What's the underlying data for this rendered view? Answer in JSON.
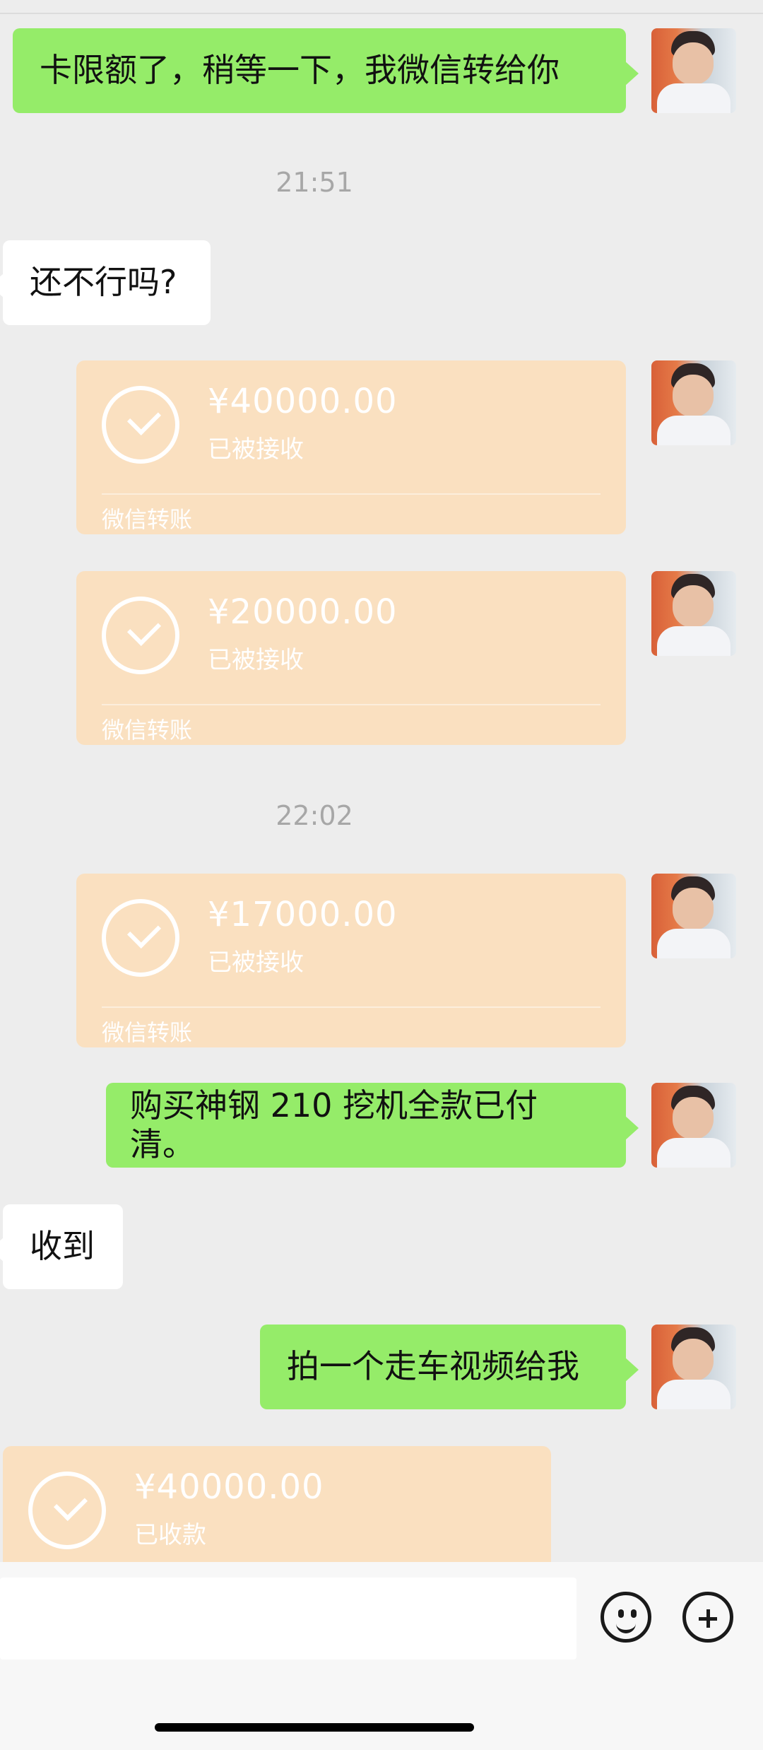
{
  "messages": {
    "outgoing_1": "卡限额了，稍等一下，我微信转给你",
    "incoming_1": "还不行吗?",
    "outgoing_2": "购买神钢 210 挖机全款已付清。",
    "incoming_2": "收到",
    "outgoing_3": "拍一个走车视频给我"
  },
  "timestamps": {
    "time_1": "21:51",
    "time_2": "22:02"
  },
  "transfers": [
    {
      "amount": "¥40000.00",
      "status": "已被接收",
      "label": "微信转账"
    },
    {
      "amount": "¥20000.00",
      "status": "已被接收",
      "label": "微信转账"
    },
    {
      "amount": "¥17000.00",
      "status": "已被接收",
      "label": "微信转账"
    },
    {
      "amount": "¥40000.00",
      "status": "已收款"
    }
  ],
  "icons": {
    "emoji": "emoji-icon",
    "plus": "plus-icon"
  },
  "colors": {
    "background": "#ededed",
    "outgoing_bubble": "#95ec69",
    "incoming_bubble": "#ffffff",
    "transfer_card": "#fae0c0"
  }
}
